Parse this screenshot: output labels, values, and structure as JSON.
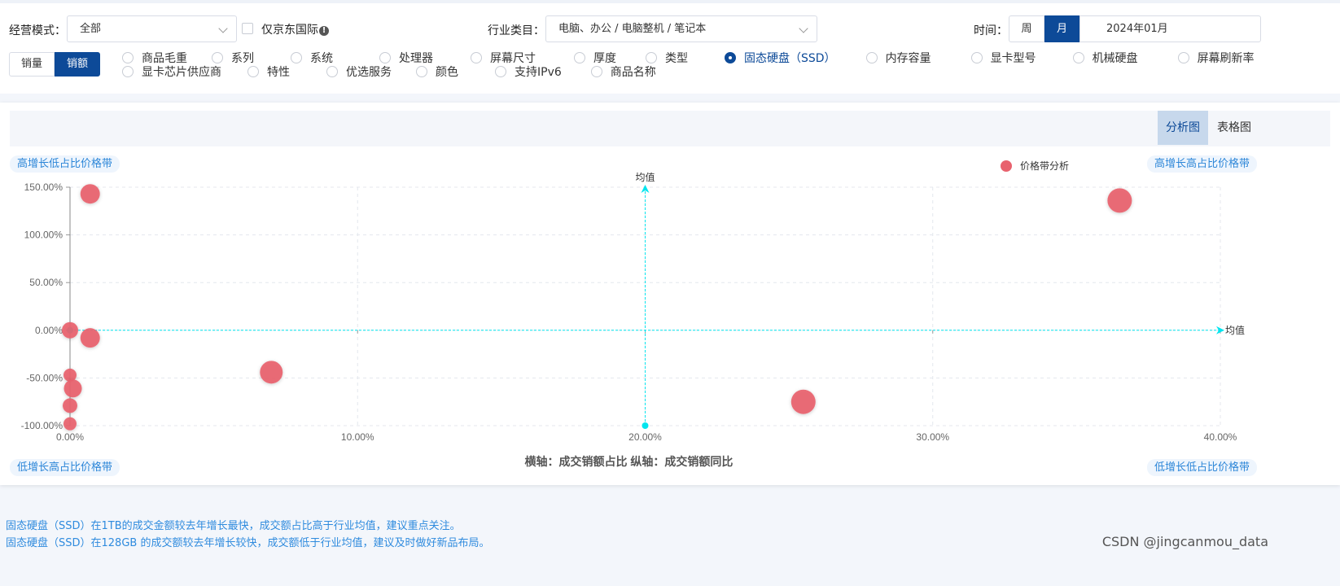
{
  "filters": {
    "mode_label": "经营模式：",
    "mode_value": "全部",
    "jd_intl_label": "仅京东国际",
    "jd_intl_checked": false,
    "info_icon": "info-circle-icon",
    "industry_label": "行业类目：",
    "industry_value": "电脑、办公 / 电脑整机 / 笔记本",
    "time_label": "时间：",
    "time_week": "周",
    "time_month": "月",
    "time_value": "2024年01月",
    "metric_volume": "销量",
    "metric_amount": "销额"
  },
  "dimensions": {
    "row1": [
      {
        "label": "商品毛重",
        "checked": false
      },
      {
        "label": "系列",
        "checked": false
      },
      {
        "label": "系统",
        "checked": false
      },
      {
        "label": "处理器",
        "checked": false
      },
      {
        "label": "屏幕尺寸",
        "checked": false
      },
      {
        "label": "厚度",
        "checked": false
      },
      {
        "label": "类型",
        "checked": false
      },
      {
        "label": "固态硬盘（SSD）",
        "checked": true
      },
      {
        "label": "内存容量",
        "checked": false
      },
      {
        "label": "显卡型号",
        "checked": false
      },
      {
        "label": "机械硬盘",
        "checked": false
      },
      {
        "label": "屏幕刷新率",
        "checked": false
      }
    ],
    "row2": [
      {
        "label": "显卡芯片供应商",
        "checked": false
      },
      {
        "label": "特性",
        "checked": false
      },
      {
        "label": "优选服务",
        "checked": false
      },
      {
        "label": "颜色",
        "checked": false
      },
      {
        "label": "支持IPv6",
        "checked": false
      },
      {
        "label": "商品名称",
        "checked": false
      }
    ]
  },
  "chart_tabs": {
    "analysis": "分析图",
    "table": "表格图"
  },
  "quadrants": {
    "top_left": "高增长低占比价格带",
    "top_right": "高增长高占比价格带",
    "bottom_left": "低增长高占比价格带",
    "bottom_right": "低增长低占比价格带"
  },
  "chart_data": {
    "type": "scatter",
    "legend": [
      "价格带分析"
    ],
    "legend_position": "top-right",
    "xlabel": "横轴：成交销额占比  纵轴：成交销额同比",
    "xlim": [
      0,
      40
    ],
    "ylim": [
      -100,
      150
    ],
    "x_ticks": [
      "0.00%",
      "10.00%",
      "20.00%",
      "30.00%",
      "40.00%"
    ],
    "y_ticks": [
      "150.00%",
      "100.00%",
      "50.00%",
      "0.00%",
      "-50.00%",
      "-100.00%"
    ],
    "mean_line_label": "均值",
    "mean_x": 20,
    "mean_y": 0,
    "grid": true,
    "color": "#e8626e",
    "mean_line_color": "#00e5ee",
    "points": [
      {
        "x": 0.7,
        "y": 143,
        "size": 12
      },
      {
        "x": 36.5,
        "y": 136,
        "size": 15
      },
      {
        "x": 0.0,
        "y": 0,
        "size": 10
      },
      {
        "x": 0.7,
        "y": -8,
        "size": 12
      },
      {
        "x": 7.0,
        "y": -44,
        "size": 14
      },
      {
        "x": 25.5,
        "y": -75,
        "size": 15
      },
      {
        "x": 0.0,
        "y": -47,
        "size": 8
      },
      {
        "x": 0.1,
        "y": -61,
        "size": 11
      },
      {
        "x": 0.0,
        "y": -79,
        "size": 9
      },
      {
        "x": 0.0,
        "y": -98,
        "size": 8
      }
    ]
  },
  "notes": [
    "固态硬盘（SSD）在1TB的成交金额较去年增长最快，成交额占比高于行业均值，建议重点关注。",
    "固态硬盘（SSD）在128GB 的成交额较去年增长较快，成交额低于行业均值，建议及时做好新品布局。"
  ],
  "watermark": "CSDN @jingcanmou_data"
}
